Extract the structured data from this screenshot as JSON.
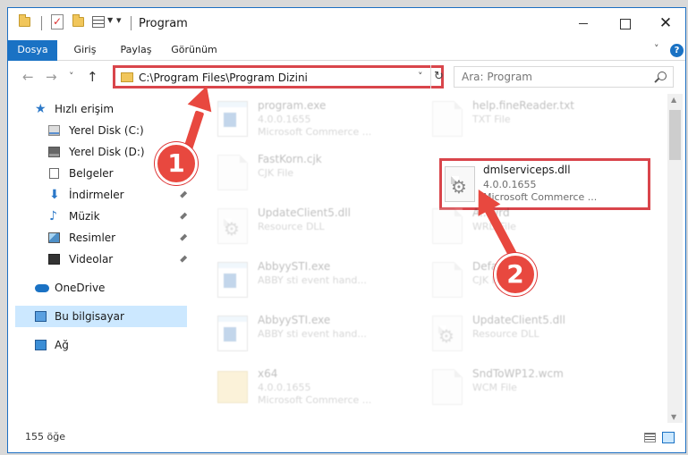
{
  "window": {
    "title": "Program",
    "controls": {
      "minimize": "—",
      "maximize": "☐",
      "close": "✕"
    }
  },
  "ribbon": {
    "tabs": [
      {
        "label": "Dosya"
      },
      {
        "label": "Giriş"
      },
      {
        "label": "Paylaş"
      },
      {
        "label": "Görünüm"
      }
    ],
    "expand_icon": "chevron-down-icon",
    "help_icon": "help-icon"
  },
  "navigation": {
    "back": "←",
    "forward": "→",
    "recent": "˅",
    "up": "↑"
  },
  "address_bar": {
    "path": "C:\\Program Files\\Program Dizini",
    "dropdown": "˅",
    "refresh": "↻"
  },
  "search": {
    "placeholder": "Ara: Program"
  },
  "nav_pane": {
    "items": [
      {
        "label": "Hızlı erişim",
        "icon": "star-icon"
      },
      {
        "label": "Yerel Disk (C:)",
        "icon": "drive-icon"
      },
      {
        "label": "Yerel Disk (D:)",
        "icon": "drive-icon"
      },
      {
        "label": "Belgeler",
        "icon": "documents-icon"
      },
      {
        "label": "İndirmeler",
        "icon": "download-icon",
        "pinned": true
      },
      {
        "label": "Müzik",
        "icon": "music-icon",
        "pinned": true
      },
      {
        "label": "Resimler",
        "icon": "pictures-icon",
        "pinned": true
      },
      {
        "label": "Videolar",
        "icon": "videos-icon",
        "pinned": true
      },
      {
        "label": "OneDrive",
        "icon": "cloud-icon"
      },
      {
        "label": "Bu bilgisayar",
        "icon": "computer-icon",
        "selected": true
      },
      {
        "label": "Ağ",
        "icon": "network-icon"
      }
    ],
    "pin_glyph": "📌"
  },
  "files": [
    {
      "name": "program.exe",
      "line1": "4.0.0.1655",
      "line2": "Microsoft Commerce ...",
      "icon": "application-icon"
    },
    {
      "name": "help.fineReader.txt",
      "line1": "TXT File",
      "line2": "",
      "icon": "text-file-icon"
    },
    {
      "name": "FastKorn.cjk",
      "line1": "CJK File",
      "line2": "",
      "icon": "file-icon"
    },
    {
      "name": "dmlserviceps.dll",
      "line1": "4.0.0.1655",
      "line2": "Microsoft Commerce ...",
      "icon": "dll-gear-icon",
      "highlighted": true
    },
    {
      "name": "UpdateClient5.dll",
      "line1": "Resource DLL",
      "line2": "",
      "icon": "dll-gear-icon"
    },
    {
      "name": "A...wrd",
      "line1": "WRD File",
      "line2": "",
      "icon": "file-icon"
    },
    {
      "name": "AbbyySTI.exe",
      "line1": "ABBY sti event hand...",
      "line2": "",
      "icon": "application-icon"
    },
    {
      "name": "Defa...t.cjk",
      "line1": "CJK File",
      "line2": "",
      "icon": "file-icon"
    },
    {
      "name": "AbbyySTI.exe",
      "line1": "ABBY sti event hand...",
      "line2": "",
      "icon": "application-icon"
    },
    {
      "name": "UpdateClient5.dll",
      "line1": "Resource DLL",
      "line2": "",
      "icon": "dll-gear-icon"
    },
    {
      "name": "x64",
      "line1": "4.0.0.1655",
      "line2": "Microsoft Commerce ...",
      "icon": "folder-icon"
    },
    {
      "name": "SndToWP12.wcm",
      "line1": "WCM File",
      "line2": "",
      "icon": "file-icon"
    }
  ],
  "status": {
    "item_count": "155 öğe"
  },
  "annotations": {
    "step1": "1",
    "step2": "2"
  },
  "colors": {
    "accent": "#1a72c4",
    "highlight_border": "#d9454b",
    "annotation": "#e8483f",
    "selection": "#cce8ff"
  }
}
